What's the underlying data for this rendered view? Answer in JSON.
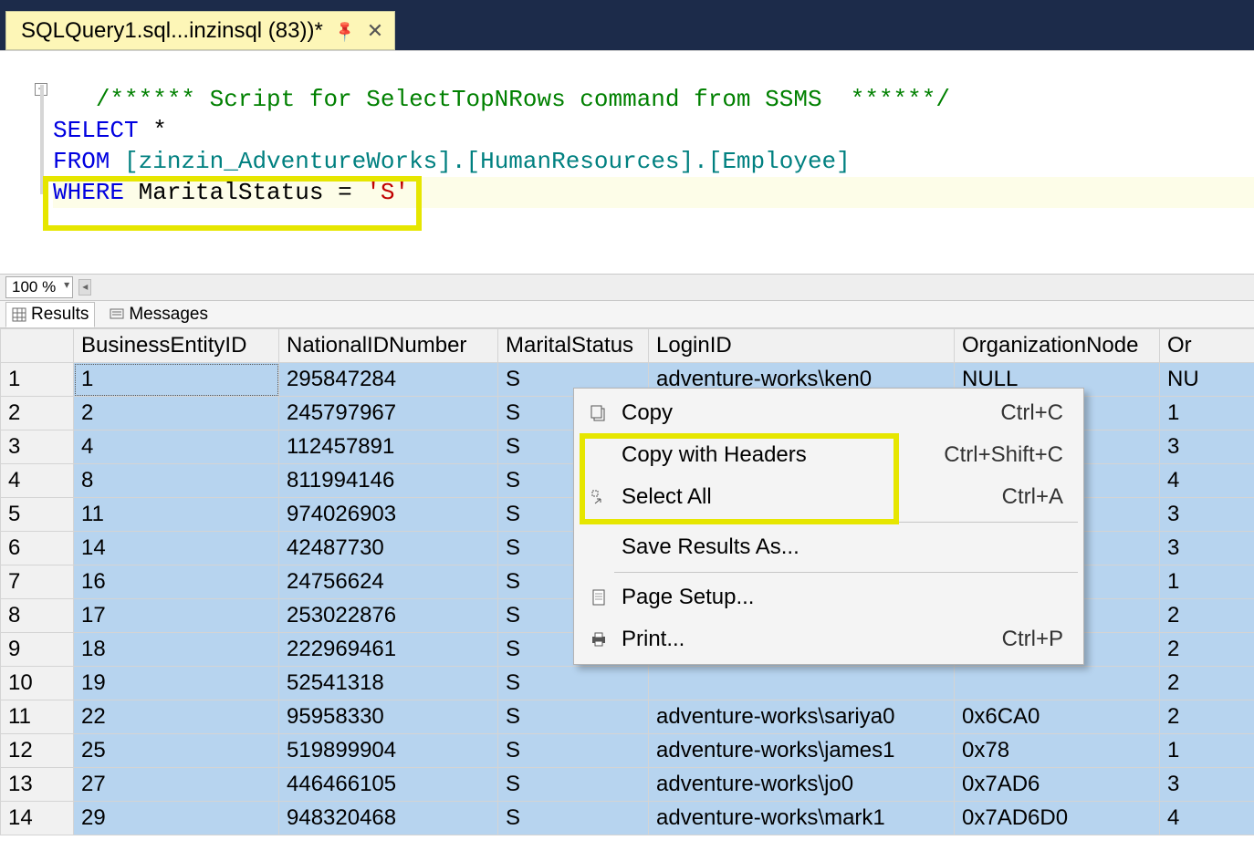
{
  "tab": {
    "title": "SQLQuery1.sql...inzinsql (83))*"
  },
  "code": {
    "comment": "/****** Script for SelectTopNRows command from SSMS  ******/",
    "select_kw": "SELECT",
    "select_rest": " *",
    "from_kw": "FROM",
    "from_ident": " [zinzin_AdventureWorks].[HumanResources].[Employee]",
    "where_kw": "WHERE",
    "where_ident": " MaritalStatus ",
    "eq": "= ",
    "where_val": "'S'"
  },
  "zoom": {
    "value": "100 %"
  },
  "result_tabs": {
    "results": "Results",
    "messages": "Messages"
  },
  "columns": [
    "BusinessEntityID",
    "NationalIDNumber",
    "MaritalStatus",
    "LoginID",
    "OrganizationNode",
    "Or"
  ],
  "rows": [
    {
      "n": "1",
      "be": "1",
      "nid": "295847284",
      "ms": "S",
      "login": "adventure-works\\ken0",
      "org": "NULL",
      "ol": "NU"
    },
    {
      "n": "2",
      "be": "2",
      "nid": "245797967",
      "ms": "S",
      "login": "",
      "org": "",
      "ol": "1"
    },
    {
      "n": "3",
      "be": "4",
      "nid": "112457891",
      "ms": "S",
      "login": "",
      "org": "",
      "ol": "3"
    },
    {
      "n": "4",
      "be": "8",
      "nid": "811994146",
      "ms": "S",
      "login": "",
      "org": "",
      "ol": "4"
    },
    {
      "n": "5",
      "be": "11",
      "nid": "974026903",
      "ms": "S",
      "login": "",
      "org": "",
      "ol": "3"
    },
    {
      "n": "6",
      "be": "14",
      "nid": "42487730",
      "ms": "S",
      "login": "",
      "org": "",
      "ol": "3"
    },
    {
      "n": "7",
      "be": "16",
      "nid": "24756624",
      "ms": "S",
      "login": "",
      "org": "",
      "ol": "1"
    },
    {
      "n": "8",
      "be": "17",
      "nid": "253022876",
      "ms": "S",
      "login": "",
      "org": "",
      "ol": "2"
    },
    {
      "n": "9",
      "be": "18",
      "nid": "222969461",
      "ms": "S",
      "login": "",
      "org": "",
      "ol": "2"
    },
    {
      "n": "10",
      "be": "19",
      "nid": "52541318",
      "ms": "S",
      "login": "",
      "org": "",
      "ol": "2"
    },
    {
      "n": "11",
      "be": "22",
      "nid": "95958330",
      "ms": "S",
      "login": "adventure-works\\sariya0",
      "org": "0x6CA0",
      "ol": "2"
    },
    {
      "n": "12",
      "be": "25",
      "nid": "519899904",
      "ms": "S",
      "login": "adventure-works\\james1",
      "org": "0x78",
      "ol": "1"
    },
    {
      "n": "13",
      "be": "27",
      "nid": "446466105",
      "ms": "S",
      "login": "adventure-works\\jo0",
      "org": "0x7AD6",
      "ol": "3"
    },
    {
      "n": "14",
      "be": "29",
      "nid": "948320468",
      "ms": "S",
      "login": "adventure-works\\mark1",
      "org": "0x7AD6D0",
      "ol": "4"
    }
  ],
  "menu": {
    "copy": "Copy",
    "copy_key": "Ctrl+C",
    "copy_headers": "Copy with Headers",
    "copy_headers_key": "Ctrl+Shift+C",
    "select_all": "Select All",
    "select_all_key": "Ctrl+A",
    "save": "Save Results As...",
    "page_setup": "Page Setup...",
    "print": "Print...",
    "print_key": "Ctrl+P"
  },
  "colors": {
    "highlight": "#e6e600"
  }
}
